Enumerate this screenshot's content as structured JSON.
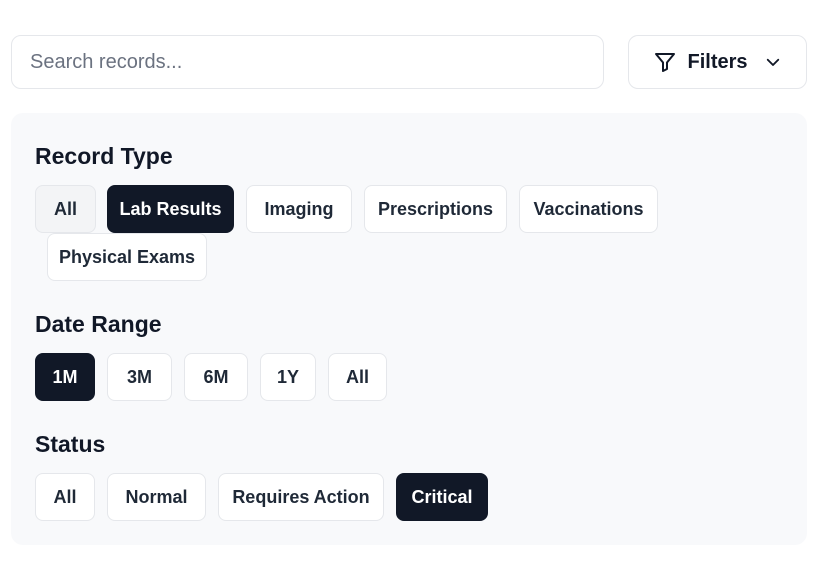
{
  "search": {
    "placeholder": "Search records..."
  },
  "filters_button": {
    "label": "Filters"
  },
  "record_type": {
    "title": "Record Type",
    "options": [
      "All",
      "Lab Results",
      "Imaging",
      "Prescriptions",
      "Vaccinations",
      "Physical Exams"
    ],
    "selected": "Lab Results"
  },
  "date_range": {
    "title": "Date Range",
    "options": [
      "1M",
      "3M",
      "6M",
      "1Y",
      "All"
    ],
    "selected": "1M"
  },
  "status": {
    "title": "Status",
    "options": [
      "All",
      "Normal",
      "Requires Action",
      "Critical"
    ],
    "selected": "Critical"
  },
  "colors": {
    "accent": "#111827",
    "panel_bg": "#f8f9fb",
    "border": "#e5e7eb"
  }
}
